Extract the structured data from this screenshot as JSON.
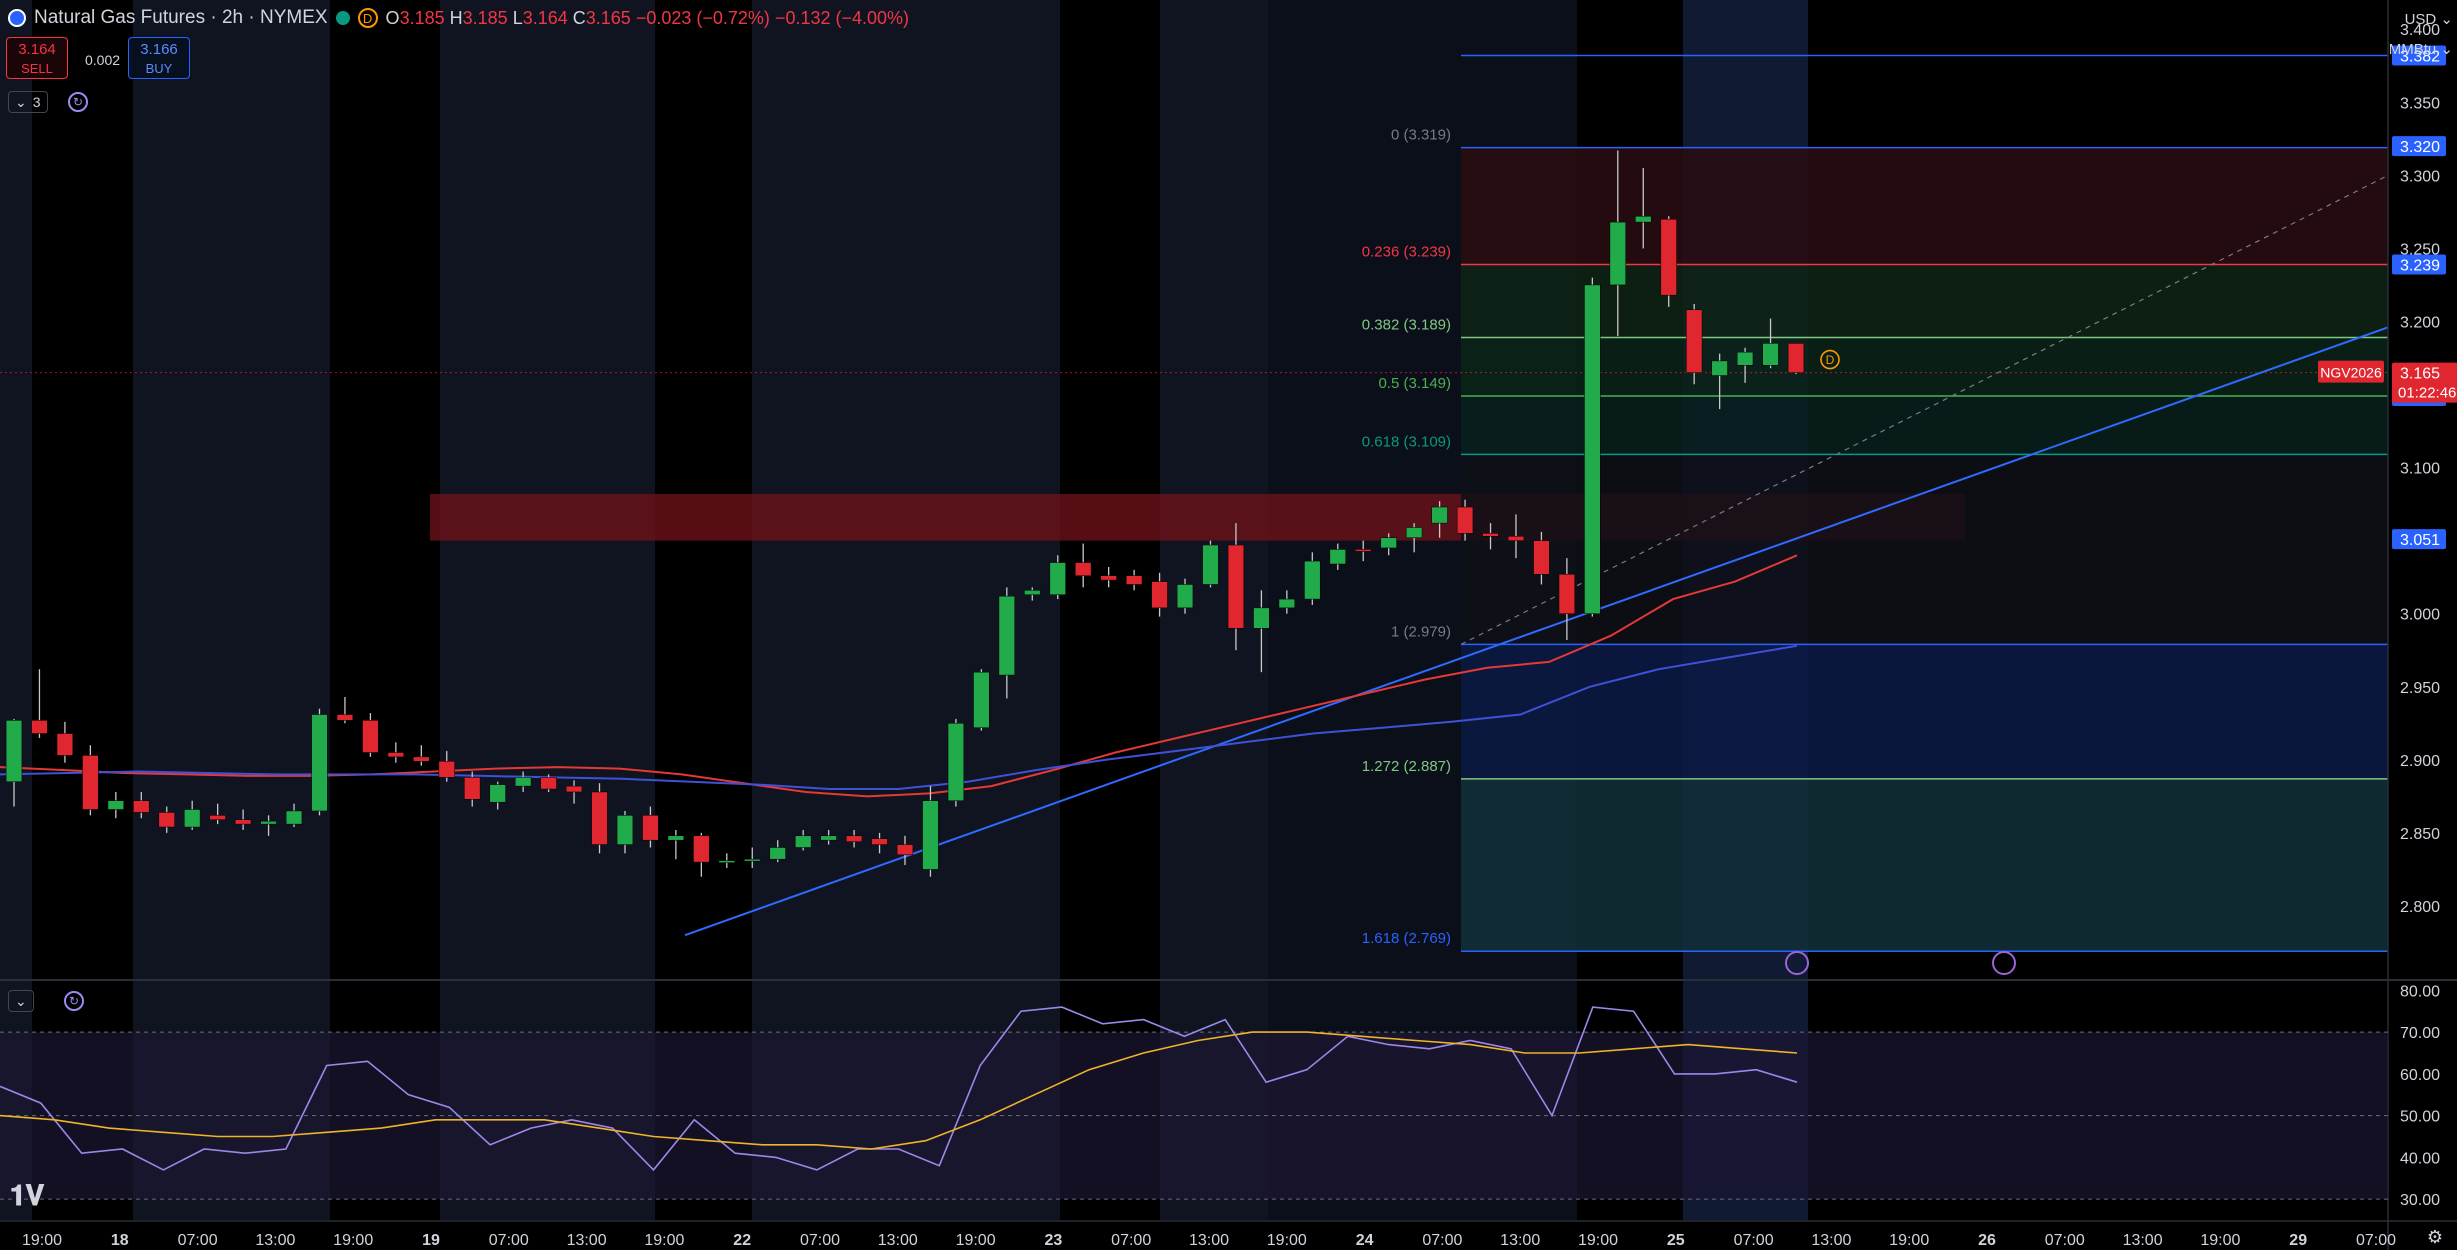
{
  "header": {
    "title": "Natural Gas Futures · 2h · NYMEX",
    "badge": "D",
    "open_label": "O",
    "open": "3.185",
    "high_label": "H",
    "high": "3.185",
    "low_label": "L",
    "low": "3.164",
    "close_label": "C",
    "close": "3.165",
    "change": "−0.023 (−0.72%)",
    "change2": "−0.132 (−4.00%)"
  },
  "trade": {
    "sell_price": "3.164",
    "sell_label": "SELL",
    "spread": "0.002",
    "buy_price": "3.166",
    "buy_label": "BUY"
  },
  "controls": {
    "indicator_count": "3"
  },
  "price_axis": {
    "currency": "USD",
    "unit": "MMBtu",
    "ticks": [
      "3.400",
      "3.350",
      "3.300",
      "3.250",
      "3.200",
      "3.150",
      "3.100",
      "3.050",
      "3.000",
      "2.950",
      "2.900",
      "2.850",
      "2.800"
    ]
  },
  "colors": {
    "up": "#22ab4a",
    "down": "#e0262f",
    "fib": "#2962ff",
    "ma_red": "#e53935",
    "ma_blue": "#3f51d8",
    "rsi": "#9c88e8",
    "rsi_ma": "#f0b429"
  },
  "chart_data": [
    {
      "type": "candlestick",
      "symbol": "NGV2026",
      "ylim": [
        2.75,
        3.42
      ],
      "x_ticks": [
        "19:00",
        "18",
        "07:00",
        "13:00",
        "19:00",
        "19",
        "07:00",
        "13:00",
        "19:00",
        "22",
        "07:00",
        "13:00",
        "19:00",
        "23",
        "07:00",
        "13:00",
        "19:00",
        "24",
        "07:00",
        "13:00",
        "19:00",
        "25",
        "07:00",
        "13:00",
        "19:00",
        "26",
        "07:00",
        "13:00",
        "19:00",
        "29",
        "07:00"
      ],
      "candles": [
        [
          2.885,
          2.928,
          2.868,
          2.927
        ],
        [
          2.927,
          2.962,
          2.915,
          2.918
        ],
        [
          2.918,
          2.926,
          2.898,
          2.903
        ],
        [
          2.903,
          2.91,
          2.862,
          2.866
        ],
        [
          2.866,
          2.878,
          2.86,
          2.872
        ],
        [
          2.872,
          2.878,
          2.86,
          2.864
        ],
        [
          2.864,
          2.868,
          2.85,
          2.854
        ],
        [
          2.854,
          2.872,
          2.852,
          2.866
        ],
        [
          2.862,
          2.87,
          2.856,
          2.859
        ],
        [
          2.859,
          2.866,
          2.852,
          2.856
        ],
        [
          2.856,
          2.862,
          2.848,
          2.858
        ],
        [
          2.856,
          2.87,
          2.854,
          2.865
        ],
        [
          2.865,
          2.935,
          2.862,
          2.931
        ],
        [
          2.931,
          2.943,
          2.925,
          2.927
        ],
        [
          2.927,
          2.932,
          2.902,
          2.905
        ],
        [
          2.905,
          2.912,
          2.898,
          2.902
        ],
        [
          2.902,
          2.91,
          2.896,
          2.899
        ],
        [
          2.899,
          2.906,
          2.885,
          2.888
        ],
        [
          2.888,
          2.892,
          2.868,
          2.873
        ],
        [
          2.871,
          2.885,
          2.866,
          2.883
        ],
        [
          2.882,
          2.892,
          2.878,
          2.888
        ],
        [
          2.888,
          2.89,
          2.878,
          2.88
        ],
        [
          2.882,
          2.886,
          2.87,
          2.878
        ],
        [
          2.878,
          2.884,
          2.836,
          2.842
        ],
        [
          2.842,
          2.865,
          2.836,
          2.862
        ],
        [
          2.862,
          2.868,
          2.84,
          2.845
        ],
        [
          2.845,
          2.852,
          2.832,
          2.848
        ],
        [
          2.848,
          2.85,
          2.82,
          2.83
        ],
        [
          2.83,
          2.836,
          2.826,
          2.831
        ],
        [
          2.831,
          2.84,
          2.826,
          2.832
        ],
        [
          2.832,
          2.845,
          2.83,
          2.84
        ],
        [
          2.84,
          2.852,
          2.838,
          2.848
        ],
        [
          2.845,
          2.852,
          2.842,
          2.848
        ],
        [
          2.848,
          2.852,
          2.84,
          2.844
        ],
        [
          2.846,
          2.85,
          2.836,
          2.842
        ],
        [
          2.842,
          2.848,
          2.828,
          2.835
        ],
        [
          2.825,
          2.882,
          2.82,
          2.872
        ],
        [
          2.872,
          2.928,
          2.868,
          2.925
        ],
        [
          2.922,
          2.962,
          2.92,
          2.96
        ],
        [
          2.958,
          3.018,
          2.942,
          3.012
        ],
        [
          3.013,
          3.018,
          3.009,
          3.016
        ],
        [
          3.013,
          3.04,
          3.01,
          3.035
        ],
        [
          3.035,
          3.048,
          3.018,
          3.026
        ],
        [
          3.026,
          3.032,
          3.018,
          3.023
        ],
        [
          3.026,
          3.03,
          3.016,
          3.02
        ],
        [
          3.022,
          3.028,
          2.998,
          3.004
        ],
        [
          3.004,
          3.024,
          3.0,
          3.02
        ],
        [
          3.02,
          3.05,
          3.018,
          3.047
        ],
        [
          3.047,
          3.062,
          2.975,
          2.99
        ],
        [
          2.99,
          3.016,
          2.96,
          3.004
        ],
        [
          3.004,
          3.016,
          3.0,
          3.01
        ],
        [
          3.01,
          3.042,
          3.006,
          3.036
        ],
        [
          3.034,
          3.048,
          3.03,
          3.044
        ],
        [
          3.044,
          3.05,
          3.036,
          3.043
        ],
        [
          3.045,
          3.055,
          3.04,
          3.052
        ],
        [
          3.052,
          3.062,
          3.042,
          3.059
        ],
        [
          3.062,
          3.077,
          3.052,
          3.073
        ],
        [
          3.073,
          3.078,
          3.05,
          3.055
        ],
        [
          3.055,
          3.062,
          3.044,
          3.053
        ],
        [
          3.053,
          3.068,
          3.038,
          3.05
        ],
        [
          3.05,
          3.056,
          3.02,
          3.027
        ],
        [
          3.027,
          3.038,
          2.982,
          3.0
        ],
        [
          3.0,
          3.23,
          2.998,
          3.225
        ],
        [
          3.225,
          3.317,
          3.19,
          3.268
        ],
        [
          3.268,
          3.305,
          3.25,
          3.272
        ],
        [
          3.27,
          3.272,
          3.21,
          3.218
        ],
        [
          3.208,
          3.212,
          3.157,
          3.165
        ],
        [
          3.163,
          3.178,
          3.14,
          3.173
        ],
        [
          3.17,
          3.182,
          3.158,
          3.179
        ],
        [
          3.17,
          3.202,
          3.168,
          3.185
        ],
        [
          3.185,
          3.185,
          3.164,
          3.165
        ]
      ],
      "ma_red": [
        2.895,
        2.893,
        2.891,
        2.89,
        2.889,
        2.889,
        2.89,
        2.892,
        2.894,
        2.895,
        2.894,
        2.89,
        2.884,
        2.878,
        2.875,
        2.877,
        2.882,
        2.893,
        2.905,
        2.915,
        2.925,
        2.935,
        2.945,
        2.955,
        2.963,
        2.967,
        2.985,
        3.01,
        3.022,
        3.04
      ],
      "ma_blue": [
        2.89,
        2.891,
        2.892,
        2.891,
        2.89,
        2.89,
        2.89,
        2.889,
        2.888,
        2.887,
        2.885,
        2.883,
        2.88,
        2.88,
        2.885,
        2.893,
        2.9,
        2.906,
        2.912,
        2.918,
        2.922,
        2.926,
        2.931,
        2.95,
        2.962,
        2.97,
        2.978
      ],
      "trendline": [
        [
          2.78,
          3.196
        ]
      ],
      "resistance_zone": [
        3.05,
        3.082
      ],
      "last_price": "3.165",
      "countdown": "01:22:46",
      "fib": {
        "levels": [
          {
            "label": "0 (3.319)",
            "value": 3.319,
            "color": "#787b86"
          },
          {
            "label": "0.236 (3.239)",
            "value": 3.239,
            "color": "#f23645"
          },
          {
            "label": "0.382 (3.189)",
            "value": 3.189,
            "color": "#81c784"
          },
          {
            "label": "0.5 (3.149)",
            "value": 3.149,
            "color": "#4caf50"
          },
          {
            "label": "0.618 (3.109)",
            "value": 3.109,
            "color": "#089981"
          },
          {
            "label": "1 (2.979)",
            "value": 2.979,
            "color": "#787b86"
          },
          {
            "label": "1.272 (2.887)",
            "value": 2.887,
            "color": "#81c784"
          },
          {
            "label": "1.618 (2.769)",
            "value": 2.769,
            "color": "#2962ff"
          }
        ],
        "axis_tags": [
          "3.382",
          "3.320",
          "3.239",
          "3.149",
          "3.051"
        ],
        "extra_line": 3.382
      }
    },
    {
      "type": "line",
      "name": "RSI",
      "ylim": [
        25,
        82
      ],
      "ticks": [
        "80.00",
        "70.00",
        "60.00",
        "50.00",
        "40.00",
        "30.00"
      ],
      "rsi": [
        57,
        53,
        41,
        42,
        37,
        42,
        41,
        42,
        62,
        63,
        55,
        52,
        43,
        47,
        49,
        47,
        37,
        49,
        41,
        40,
        37,
        42,
        42,
        38,
        62,
        75,
        76,
        72,
        73,
        69,
        73,
        58,
        61,
        69,
        67,
        66,
        68,
        66,
        50,
        76,
        75,
        60,
        60,
        61,
        58
      ],
      "rsi_ma": [
        50,
        49,
        47,
        46,
        45,
        45,
        46,
        47,
        49,
        49,
        49,
        47,
        45,
        44,
        43,
        43,
        42,
        44,
        49,
        55,
        61,
        65,
        68,
        70,
        70,
        69,
        68,
        67,
        65,
        65,
        66,
        67,
        66,
        65
      ]
    }
  ]
}
